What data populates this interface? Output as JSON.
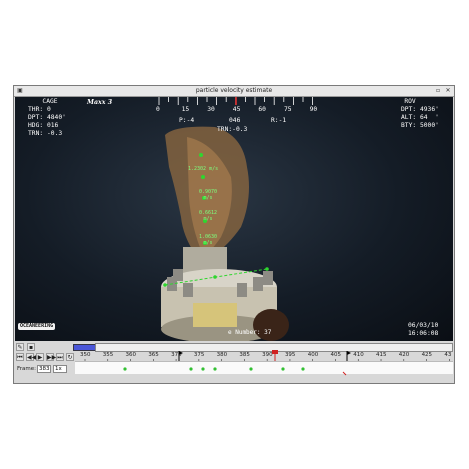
{
  "window": {
    "title": "particle velocity estimate"
  },
  "osd": {
    "cage_title": "CAGE",
    "cage_lines": [
      "THR: 0",
      "DPT: 4840'",
      "HDG: 016",
      "TRN: -0.3"
    ],
    "rov_title": "ROV",
    "rov_lines": [
      "DPT: 4936'",
      "ALT: 64  '",
      "BTY: 5000'"
    ],
    "brand_top": "Maxx 3",
    "heading_scale": [
      "0",
      "15",
      "30",
      "45",
      "60",
      "75",
      "90"
    ],
    "pitch": "P:-4",
    "heading": "046",
    "roll": "R:-1",
    "trn": "TRN:-0.3",
    "date": "06/03/10",
    "time": "16:06:08",
    "logo": "OCEANEERING",
    "dive_label": "e Number: 37"
  },
  "measurements": [
    "1.2302 m/s",
    "0.9070\nm/s",
    "0.6612\nm/s",
    "1.0630\nm/s"
  ],
  "timeline": {
    "ticks": [
      "350",
      "355",
      "360",
      "365",
      "370",
      "375",
      "380",
      "385",
      "390",
      "395",
      "400",
      "405",
      "410",
      "415",
      "420",
      "425",
      "43"
    ],
    "frame_label": "Frame:",
    "frame_value": "383",
    "speed_value": "1x"
  },
  "colors": {
    "measure": "#2fd62f",
    "playhead": "#d02020",
    "marker": "#000000"
  }
}
